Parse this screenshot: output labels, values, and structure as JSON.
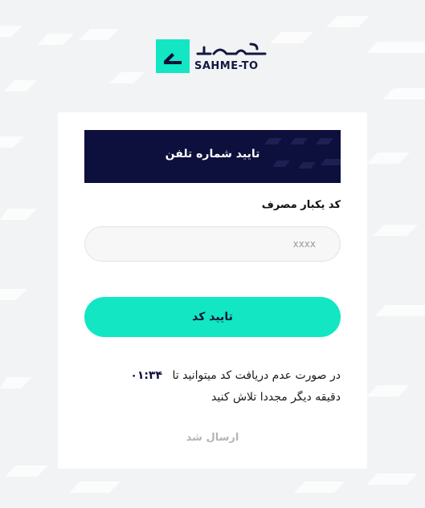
{
  "brand": {
    "name": "SAHME-TO",
    "logo_icon": "arrow-mark-icon",
    "accent_color": "#12e6c3",
    "dark_color": "#0d0f3d"
  },
  "card": {
    "title": "تایید شماره تلفن",
    "field_label": "کد یکبار مصرف",
    "code_input": {
      "value": "",
      "placeholder": "xxxx"
    },
    "confirm_label": "تایید کد",
    "info_text_line1": "در صورت عدم دریافت کد میتوانید تا",
    "timer": "۰۱:۳۴",
    "info_text_line2": "دقیقه دیگر مجددا تلاش کنید",
    "resend_label": "ارسال شد"
  }
}
